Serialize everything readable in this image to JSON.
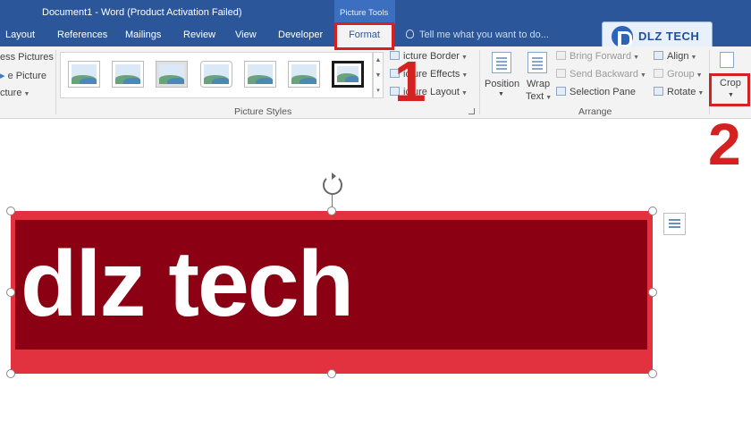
{
  "window": {
    "title": "Document1 - Word (Product Activation Failed)",
    "contextual_tab_group": "Picture Tools"
  },
  "tabs": [
    "Layout",
    "References",
    "Mailings",
    "Review",
    "View",
    "Developer"
  ],
  "active_tab": "Format",
  "tell_me_placeholder": "Tell me what you want to do...",
  "logo": {
    "text": "DLZ TECH"
  },
  "ribbon": {
    "adjust": {
      "compress": "ess Pictures",
      "change": "e Picture",
      "reset": "cture"
    },
    "picture_styles": {
      "label": "Picture Styles",
      "selected_index": 8,
      "border": "icture Border",
      "effects": "icture Effects",
      "layout": "icture Layout"
    },
    "arrange": {
      "label": "Arrange",
      "position": "Position",
      "wrap_text_1": "Wrap",
      "wrap_text_2": "Text",
      "bring_forward": "Bring Forward",
      "send_backward": "Send Backward",
      "selection_pane": "Selection Pane",
      "align": "Align",
      "group": "Group",
      "rotate": "Rotate"
    },
    "size": {
      "crop": "Crop"
    }
  },
  "annotations": {
    "step1": "1",
    "step2": "2"
  },
  "document": {
    "picture_text": "dlz tech"
  },
  "colors": {
    "word_blue": "#2b579a",
    "annotation_red": "#d42121",
    "picture_dark": "#8b0012",
    "picture_border": "#e3323f"
  }
}
